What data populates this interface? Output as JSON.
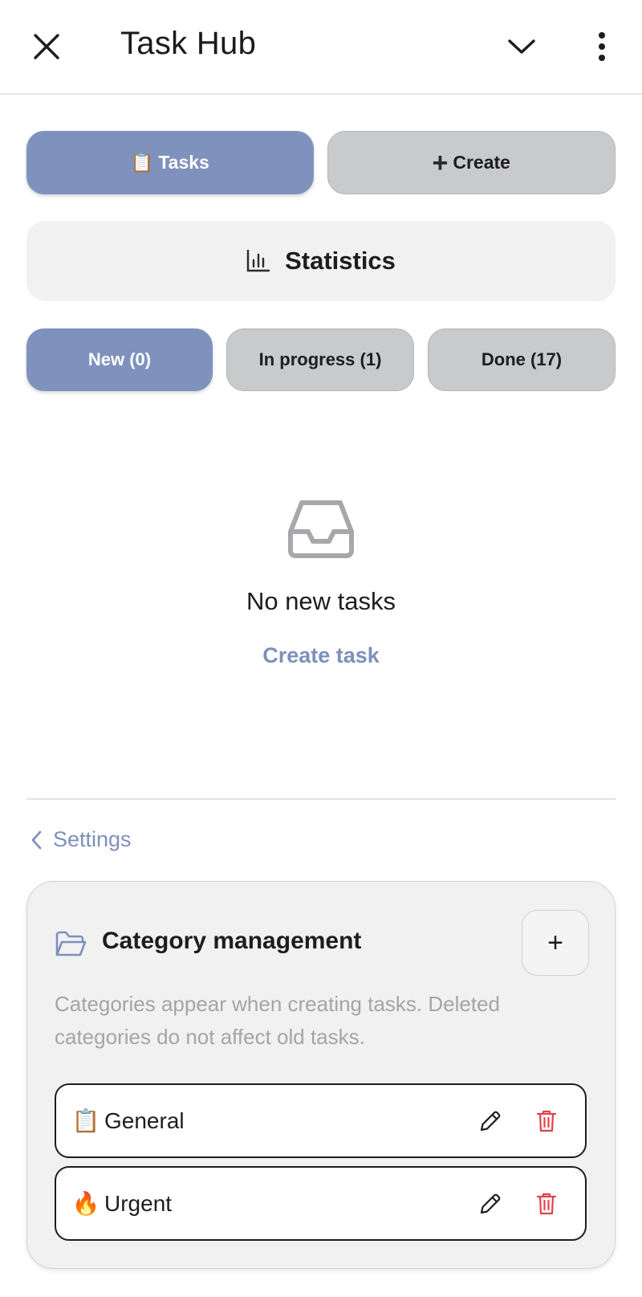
{
  "app_bar": {
    "title": "Task Hub",
    "close_icon": "close-icon",
    "dropdown_icon": "chevron-down-icon",
    "more_icon": "more-vertical-icon"
  },
  "main_tabs": {
    "tasks_emoji": "📋",
    "tasks_label": "Tasks",
    "create_glyph": "+",
    "create_label": "Create"
  },
  "statistics": {
    "icon": "bar-chart-icon",
    "label": "Statistics"
  },
  "status_tabs": [
    {
      "label": "New (0)",
      "active": true
    },
    {
      "label": "In progress (1)",
      "active": false
    },
    {
      "label": "Done (17)",
      "active": false
    }
  ],
  "empty_state": {
    "icon": "inbox-icon",
    "message": "No new tasks",
    "action_label": "Create task"
  },
  "settings": {
    "back_icon": "chevron-left-icon",
    "label": "Settings"
  },
  "category_management": {
    "icon": "folder-open-icon",
    "title": "Category management",
    "add_glyph": "+",
    "description": "Categories appear when creating tasks. Deleted categories do not affect old tasks.",
    "categories": [
      {
        "emoji": "📋",
        "name": "General"
      },
      {
        "emoji": "🔥",
        "name": "Urgent"
      }
    ],
    "edit_icon": "pencil-icon",
    "delete_icon": "trash-icon"
  },
  "colors": {
    "accent": "#7f92be",
    "link": "#7d90bb",
    "inactive_pill": "#c9cacc",
    "card_bg": "#f1f1f2",
    "danger": "#e0424d"
  }
}
